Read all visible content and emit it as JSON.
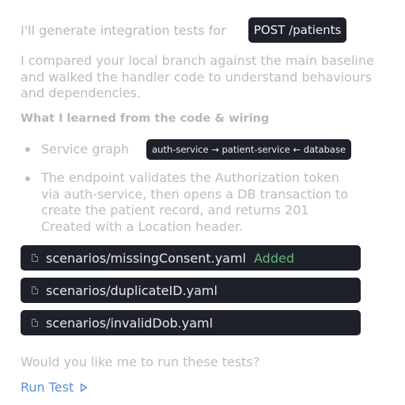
{
  "intro": {
    "text": "I'll generate integration tests for",
    "endpoint": "POST /patients"
  },
  "summary": "I compared your local branch against the main baseline and walked the handler code to understand behaviours and dependencies.",
  "section_heading": "What I learned from the code & wiring",
  "bullets": {
    "service_graph_label": "Service graph",
    "service_graph_value": "auth-service → patient-service ← database",
    "description": "The endpoint validates the Authorization token via auth-service, then opens a DB transaction to create the patient record, and returns 201 Created with a Location header."
  },
  "files": [
    {
      "name": "scenarios/missingConsent.yaml",
      "badge": "Added"
    },
    {
      "name": "scenarios/duplicateID.yaml",
      "badge": ""
    },
    {
      "name": "scenarios/invalidDob.yaml",
      "badge": ""
    }
  ],
  "question": "Would you like me to run these tests?",
  "run_test_label": "Run Test",
  "icons": {
    "file": "file-icon",
    "run": "play-icon"
  },
  "colors": {
    "pill_bg": "#1e2129",
    "added": "#5fb878",
    "link": "#5a8fd6"
  }
}
